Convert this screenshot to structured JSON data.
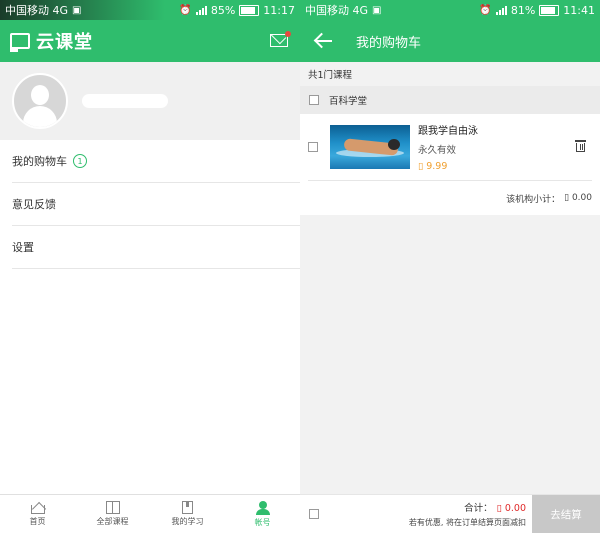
{
  "left": {
    "status": {
      "carrier": "中国移动 4G",
      "battery": "85%",
      "time": "11:17"
    },
    "app_title": "云课堂",
    "menu": [
      {
        "label": "我的购物车",
        "badge": "1"
      },
      {
        "label": "意见反馈"
      },
      {
        "label": "设置"
      }
    ],
    "tabs": [
      {
        "label": "首页"
      },
      {
        "label": "全部课程"
      },
      {
        "label": "我的学习"
      },
      {
        "label": "帐号"
      }
    ]
  },
  "right": {
    "status": {
      "carrier": "中国移动 4G",
      "battery": "81%",
      "time": "11:41"
    },
    "title": "我的购物车",
    "course_count": "共1门课程",
    "store": "百科学堂",
    "course": {
      "title": "跟我学自由泳",
      "validity": "永久有效",
      "price": "▯ 9.99"
    },
    "subtotal_label": "该机构小计：",
    "subtotal_value": "▯ 0.00",
    "total_label": "合计：",
    "total_value": "▯ 0.00",
    "discount_note": "若有优惠, 将在订单结算页面减扣",
    "checkout_label": "去结算"
  },
  "colors": {
    "brand_green": "#2fbd6d",
    "price_orange": "#f0a030",
    "total_red": "#e02a2a"
  }
}
